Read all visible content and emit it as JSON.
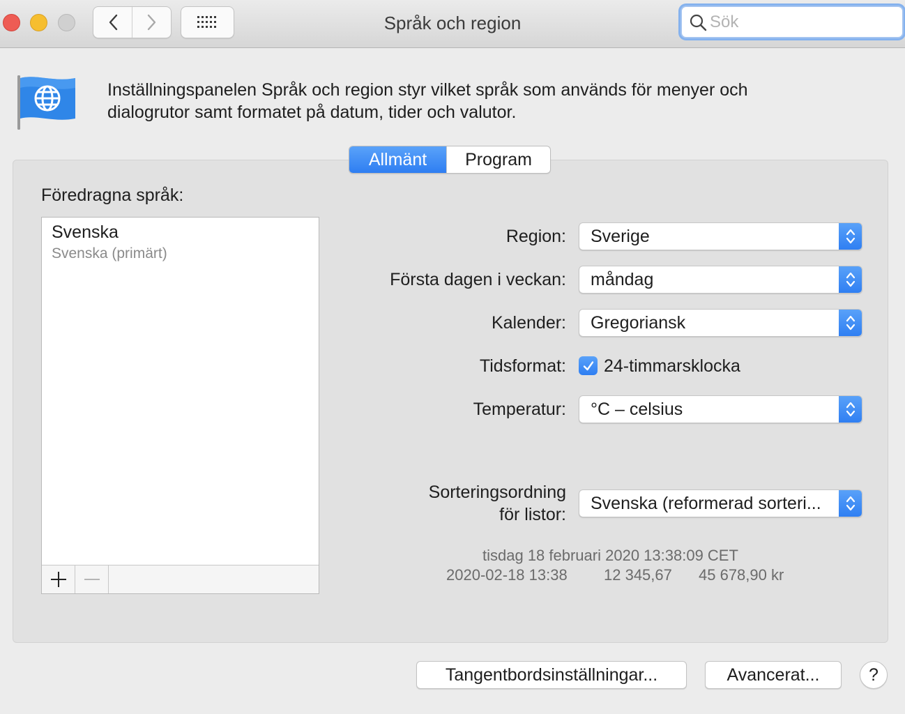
{
  "window": {
    "title": "Språk och region",
    "search_placeholder": "Sök"
  },
  "header": {
    "description": "Inställningspanelen Språk och region styr vilket språk som används för menyer och dialogrutor samt formatet på datum, tider och valutor."
  },
  "tabs": [
    {
      "label": "Allmänt",
      "active": true
    },
    {
      "label": "Program",
      "active": false
    }
  ],
  "languages": {
    "heading": "Föredragna språk:",
    "items": [
      {
        "name": "Svenska",
        "detail": "Svenska (primärt)"
      }
    ],
    "add_label": "+",
    "remove_label": "—"
  },
  "settings": {
    "region": {
      "label": "Region:",
      "value": "Sverige"
    },
    "first_day": {
      "label": "Första dagen i veckan:",
      "value": "måndag"
    },
    "calendar": {
      "label": "Kalender:",
      "value": "Gregoriansk"
    },
    "time_format": {
      "label": "Tidsformat:",
      "checkbox_label": "24-timmarsklocka",
      "checked": true
    },
    "temperature": {
      "label": "Temperatur:",
      "value": "°C – celsius"
    },
    "sort_order": {
      "label_line1": "Sorteringsordning",
      "label_line2": "för listor:",
      "value": "Svenska (reformerad sorteri..."
    }
  },
  "sample": {
    "datetime_long": "tisdag 18 februari 2020 13:38:09 CET",
    "datetime_short": "2020-02-18 13:38",
    "number": "12 345,67",
    "currency": "45 678,90 kr"
  },
  "buttons": {
    "keyboard": "Tangentbordsinställningar...",
    "advanced": "Avancerat...",
    "help": "?"
  },
  "colors": {
    "accent": "#2e7ef2",
    "close": "#ee5c54",
    "minimize": "#f6be2f"
  }
}
